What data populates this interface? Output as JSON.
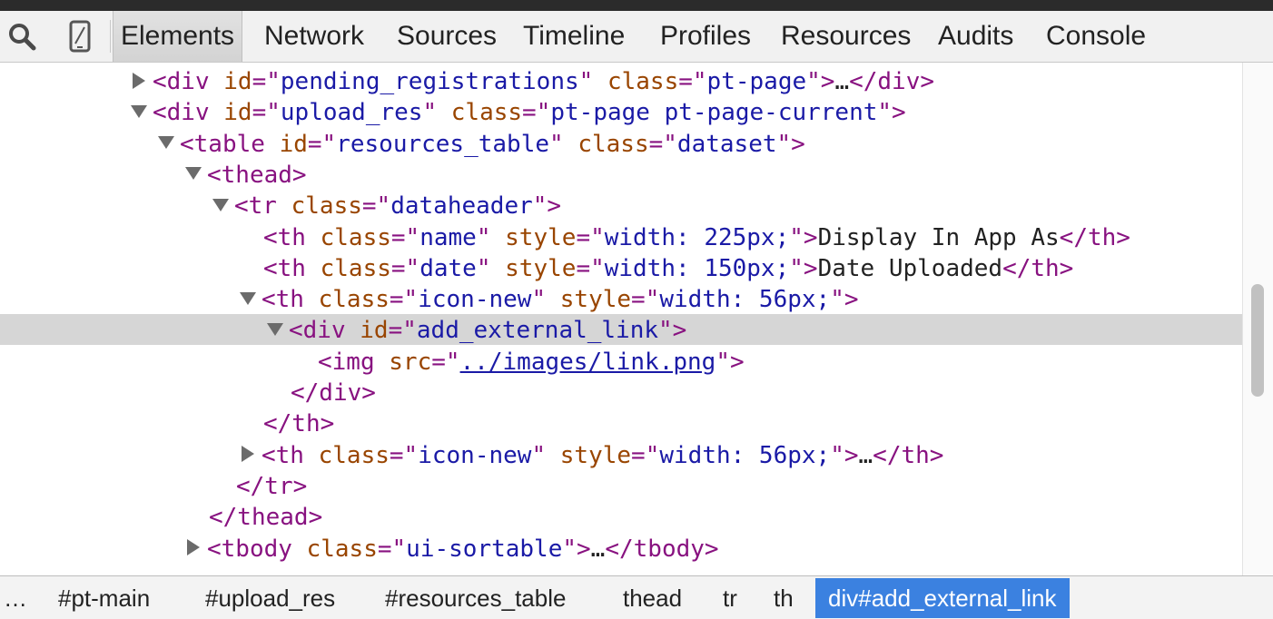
{
  "toolbar": {
    "icons": [
      "search-icon",
      "device-mode-icon"
    ],
    "tabs": [
      {
        "label": "Elements",
        "active": true
      },
      {
        "label": "Network"
      },
      {
        "label": "Sources"
      },
      {
        "label": "Timeline"
      },
      {
        "label": "Profiles"
      },
      {
        "label": "Resources"
      },
      {
        "label": "Audits"
      },
      {
        "label": "Console"
      }
    ]
  },
  "dom_tree": {
    "rows": [
      {
        "toggle": "closed",
        "tokens": [
          [
            "tag",
            "<div"
          ],
          [
            "sp",
            " "
          ],
          [
            "attr",
            "id"
          ],
          [
            "tag",
            "=\""
          ],
          [
            "val",
            "pending_registrations"
          ],
          [
            "tag",
            "\""
          ],
          [
            "sp",
            " "
          ],
          [
            "attr",
            "class"
          ],
          [
            "tag",
            "=\""
          ],
          [
            "val",
            "pt-page"
          ],
          [
            "tag",
            "\">"
          ],
          [
            "txt",
            "…"
          ],
          [
            "tag",
            "</div>"
          ]
        ]
      },
      {
        "toggle": "open",
        "tokens": [
          [
            "tag",
            "<div"
          ],
          [
            "sp",
            " "
          ],
          [
            "attr",
            "id"
          ],
          [
            "tag",
            "=\""
          ],
          [
            "val",
            "upload_res"
          ],
          [
            "tag",
            "\""
          ],
          [
            "sp",
            " "
          ],
          [
            "attr",
            "class"
          ],
          [
            "tag",
            "=\""
          ],
          [
            "val",
            "pt-page pt-page-current"
          ],
          [
            "tag",
            "\">"
          ]
        ]
      },
      {
        "toggle": "open",
        "tokens": [
          [
            "tag",
            "<table"
          ],
          [
            "sp",
            " "
          ],
          [
            "attr",
            "id"
          ],
          [
            "tag",
            "=\""
          ],
          [
            "val",
            "resources_table"
          ],
          [
            "tag",
            "\""
          ],
          [
            "sp",
            " "
          ],
          [
            "attr",
            "class"
          ],
          [
            "tag",
            "=\""
          ],
          [
            "val",
            "dataset"
          ],
          [
            "tag",
            "\">"
          ]
        ]
      },
      {
        "toggle": "open",
        "tokens": [
          [
            "tag",
            "<thead>"
          ]
        ]
      },
      {
        "toggle": "open",
        "tokens": [
          [
            "tag",
            "<tr"
          ],
          [
            "sp",
            " "
          ],
          [
            "attr",
            "class"
          ],
          [
            "tag",
            "=\""
          ],
          [
            "val",
            "dataheader"
          ],
          [
            "tag",
            "\">"
          ]
        ]
      },
      {
        "toggle": "none",
        "tokens": [
          [
            "tag",
            "<th"
          ],
          [
            "sp",
            " "
          ],
          [
            "attr",
            "class"
          ],
          [
            "tag",
            "=\""
          ],
          [
            "val",
            "name"
          ],
          [
            "tag",
            "\""
          ],
          [
            "sp",
            " "
          ],
          [
            "attr",
            "style"
          ],
          [
            "tag",
            "=\""
          ],
          [
            "val",
            "width: 225px;"
          ],
          [
            "tag",
            "\">"
          ],
          [
            "txt",
            "Display In App As"
          ],
          [
            "tag",
            "</th>"
          ]
        ]
      },
      {
        "toggle": "none",
        "tokens": [
          [
            "tag",
            "<th"
          ],
          [
            "sp",
            " "
          ],
          [
            "attr",
            "class"
          ],
          [
            "tag",
            "=\""
          ],
          [
            "val",
            "date"
          ],
          [
            "tag",
            "\""
          ],
          [
            "sp",
            " "
          ],
          [
            "attr",
            "style"
          ],
          [
            "tag",
            "=\""
          ],
          [
            "val",
            "width: 150px;"
          ],
          [
            "tag",
            "\">"
          ],
          [
            "txt",
            "Date Uploaded"
          ],
          [
            "tag",
            "</th>"
          ]
        ]
      },
      {
        "toggle": "open",
        "tokens": [
          [
            "tag",
            "<th"
          ],
          [
            "sp",
            " "
          ],
          [
            "attr",
            "class"
          ],
          [
            "tag",
            "=\""
          ],
          [
            "val",
            "icon-new"
          ],
          [
            "tag",
            "\""
          ],
          [
            "sp",
            " "
          ],
          [
            "attr",
            "style"
          ],
          [
            "tag",
            "=\""
          ],
          [
            "val",
            "width: 56px;"
          ],
          [
            "tag",
            "\">"
          ]
        ]
      },
      {
        "toggle": "open",
        "selected": true,
        "tokens": [
          [
            "tag",
            "<div"
          ],
          [
            "sp",
            " "
          ],
          [
            "attr",
            "id"
          ],
          [
            "tag",
            "=\""
          ],
          [
            "val",
            "add_external_link"
          ],
          [
            "tag",
            "\">"
          ]
        ]
      },
      {
        "toggle": "none",
        "tokens": [
          [
            "tag",
            "<img"
          ],
          [
            "sp",
            " "
          ],
          [
            "attr",
            "src"
          ],
          [
            "tag",
            "=\""
          ],
          [
            "link",
            "../images/link.png"
          ],
          [
            "tag",
            "\">"
          ]
        ]
      },
      {
        "toggle": "none",
        "tokens": [
          [
            "tag",
            "</div>"
          ]
        ]
      },
      {
        "toggle": "none",
        "tokens": [
          [
            "tag",
            "</th>"
          ]
        ]
      },
      {
        "toggle": "closed",
        "tokens": [
          [
            "tag",
            "<th"
          ],
          [
            "sp",
            " "
          ],
          [
            "attr",
            "class"
          ],
          [
            "tag",
            "=\""
          ],
          [
            "val",
            "icon-new"
          ],
          [
            "tag",
            "\""
          ],
          [
            "sp",
            " "
          ],
          [
            "attr",
            "style"
          ],
          [
            "tag",
            "=\""
          ],
          [
            "val",
            "width: 56px;"
          ],
          [
            "tag",
            "\">"
          ],
          [
            "txt",
            "…"
          ],
          [
            "tag",
            "</th>"
          ]
        ]
      },
      {
        "toggle": "none",
        "tokens": [
          [
            "tag",
            "</tr>"
          ]
        ]
      },
      {
        "toggle": "none",
        "tokens": [
          [
            "tag",
            "</thead>"
          ]
        ]
      },
      {
        "toggle": "closed",
        "tokens": [
          [
            "tag",
            "<tbody"
          ],
          [
            "sp",
            " "
          ],
          [
            "attr",
            "class"
          ],
          [
            "tag",
            "=\""
          ],
          [
            "val",
            "ui-sortable"
          ],
          [
            "tag",
            "\">"
          ],
          [
            "txt",
            "…"
          ],
          [
            "tag",
            "</tbody>"
          ]
        ]
      }
    ]
  },
  "breadcrumbs": [
    {
      "label": "…"
    },
    {
      "label": "#pt-main"
    },
    {
      "label": "#upload_res"
    },
    {
      "label": "#resources_table"
    },
    {
      "label": "thead"
    },
    {
      "label": "tr"
    },
    {
      "label": "th"
    },
    {
      "label": "div#add_external_link",
      "current": true
    }
  ],
  "colors": {
    "tag": "#881280",
    "attribute_name": "#994500",
    "attribute_value": "#1a1aa6",
    "selection": "#d6d6d6",
    "breadcrumb_current": "#3b81e0"
  }
}
